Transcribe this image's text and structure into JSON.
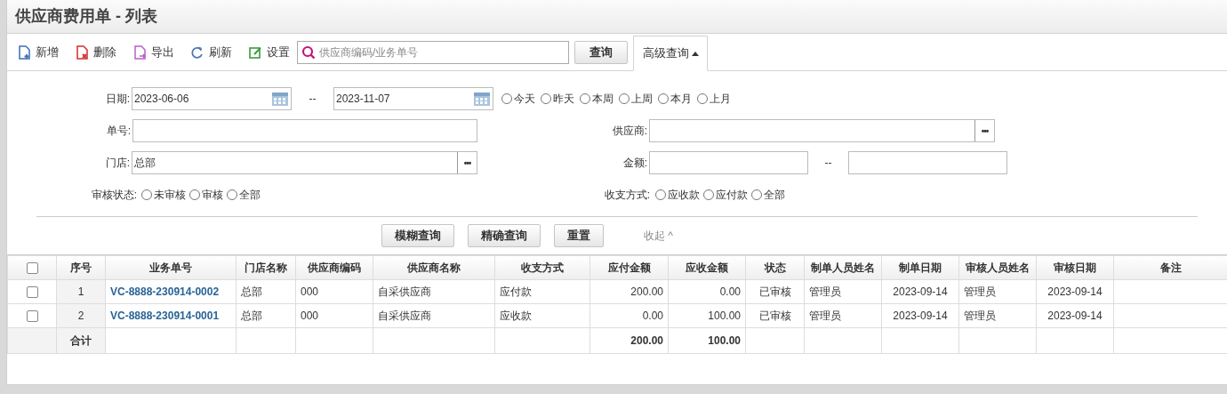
{
  "title": "供应商费用单 - 列表",
  "toolbar": {
    "buttons": [
      {
        "kind": "add",
        "label": "新增"
      },
      {
        "kind": "delete",
        "label": "删除"
      },
      {
        "kind": "export",
        "label": "导出"
      },
      {
        "kind": "refresh",
        "label": "刷新"
      },
      {
        "kind": "settings",
        "label": "设置"
      }
    ],
    "search": {
      "placeholder": "供应商编码/业务单号"
    },
    "search_button": "查询",
    "advanced_button": {
      "label": "高级查询",
      "expanded": true
    }
  },
  "filters": {
    "date": {
      "label": "日期:",
      "from": "2023-06-06",
      "separator": "--",
      "to": "2023-11-07"
    },
    "quick_ranges": [
      {
        "label": "今天",
        "selected": false
      },
      {
        "label": "昨天",
        "selected": false
      },
      {
        "label": "本周",
        "selected": false
      },
      {
        "label": "上周",
        "selected": false
      },
      {
        "label": "本月",
        "selected": false
      },
      {
        "label": "上月",
        "selected": false
      }
    ],
    "order_no": {
      "label": "单号:"
    },
    "supplier": {
      "label": "供应商:",
      "picker": "•••"
    },
    "store": {
      "label": "门店:",
      "value": "总部",
      "picker": "•••"
    },
    "amount": {
      "label": "金额:",
      "separator": "--"
    },
    "audit_status": {
      "label": "审核状态:",
      "options": [
        {
          "label": "未审核",
          "selected": false
        },
        {
          "label": "审核",
          "selected": false
        },
        {
          "label": "全部",
          "selected": false
        }
      ]
    },
    "payment_type": {
      "label": "收支方式:",
      "options": [
        {
          "label": "应收款",
          "selected": false
        },
        {
          "label": "应付款",
          "selected": false
        },
        {
          "label": "全部",
          "selected": false
        }
      ]
    }
  },
  "actions": {
    "buttons": [
      "模糊查询",
      "精确查询",
      "重置"
    ],
    "collapse": "收起 ^"
  },
  "table": {
    "select_all": false,
    "columns": [
      "序号",
      "业务单号",
      "门店名称",
      "供应商编码",
      "供应商名称",
      "收支方式",
      "应付金额",
      "应收金额",
      "状态",
      "制单人员姓名",
      "制单日期",
      "审核人员姓名",
      "审核日期",
      "备注"
    ],
    "rows": [
      {
        "selected": false,
        "cells": [
          "1",
          "VC-8888-230914-0002",
          "总部",
          "000",
          "自采供应商",
          "应付款",
          "200.00",
          "0.00",
          "已审核",
          "管理员",
          "2023-09-14",
          "管理员",
          "2023-09-14"
        ]
      },
      {
        "selected": false,
        "cells": [
          "2",
          "VC-8888-230914-0001",
          "总部",
          "000",
          "自采供应商",
          "应收款",
          "0.00",
          "100.00",
          "已审核",
          "管理员",
          "2023-09-14",
          "管理员",
          "2023-09-14"
        ]
      }
    ],
    "totals": {
      "label": "合计",
      "payable": "200.00",
      "receivable": "100.00"
    }
  }
}
